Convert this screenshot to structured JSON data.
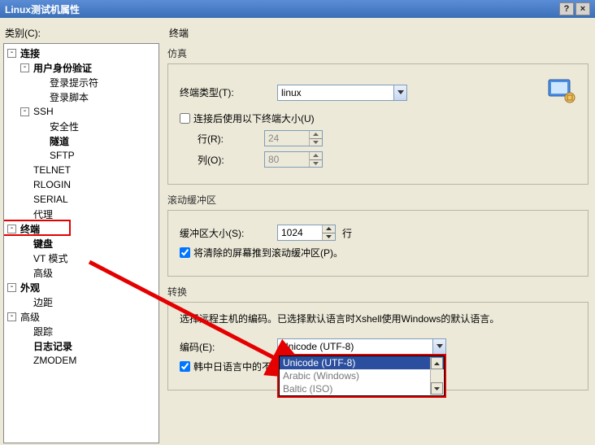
{
  "window": {
    "title": "Linux测试机属性",
    "help": "?",
    "close": "×"
  },
  "left": {
    "label": "类别(C):",
    "tree": {
      "connection": "连接",
      "auth": "用户身份验证",
      "login_prompt": "登录提示符",
      "login_script": "登录脚本",
      "ssh": "SSH",
      "security": "安全性",
      "tunnel": "隧道",
      "sftp": "SFTP",
      "telnet": "TELNET",
      "rlogin": "RLOGIN",
      "serial": "SERIAL",
      "proxy": "代理",
      "terminal": "终端",
      "keyboard": "键盘",
      "vt_mode": "VT 模式",
      "advanced_t": "高级",
      "appearance": "外观",
      "margin": "边距",
      "advanced": "高级",
      "trace": "跟踪",
      "log": "日志记录",
      "zmodem": "ZMODEM"
    }
  },
  "right": {
    "title": "终端",
    "emulation": {
      "legend": "仿真",
      "type_label": "终端类型(T):",
      "type_value": "linux",
      "size_chk": "连接后使用以下终端大小(U)",
      "rows_label": "行(R):",
      "rows_value": "24",
      "cols_label": "列(O):",
      "cols_value": "80"
    },
    "scroll": {
      "legend": "滚动缓冲区",
      "size_label": "缓冲区大小(S):",
      "size_value": "1024",
      "unit": "行",
      "push_chk": "将清除的屏幕推到滚动缓冲区(P)。"
    },
    "encoding": {
      "legend": "转换",
      "desc": "选择远程主机的编码。已选择默认语言时Xshell使用Windows的默认语言。",
      "enc_label": "编码(E):",
      "enc_value": "Unicode (UTF-8)",
      "cjk_chk": "韩中日语言中的不确",
      "options": [
        "Unicode (UTF-8)",
        "Arabic (Windows)",
        "Baltic (ISO)"
      ]
    }
  }
}
